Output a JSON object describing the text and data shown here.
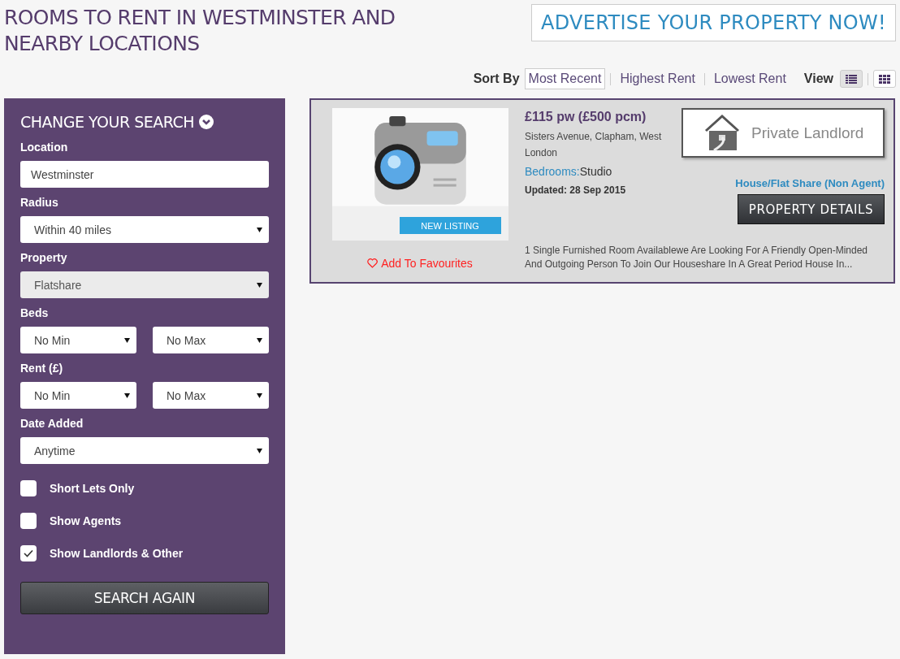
{
  "page_title": "ROOMS TO RENT IN WESTMINSTER AND NEARBY LOCATIONS",
  "advertise_button": "ADVERTISE YOUR PROPERTY NOW!",
  "sort": {
    "label": "Sort By",
    "options": [
      {
        "label": "Most Recent",
        "selected": true
      },
      {
        "label": "Highest Rent",
        "selected": false
      },
      {
        "label": "Lowest Rent",
        "selected": false
      }
    ]
  },
  "view": {
    "label": "View",
    "options": [
      {
        "kind": "list",
        "selected": true
      },
      {
        "kind": "grid",
        "selected": false
      }
    ]
  },
  "sidebar": {
    "title": "CHANGE YOUR SEARCH",
    "fields": [
      {
        "kind": "text",
        "label": "Location",
        "value": "Westminster"
      },
      {
        "kind": "select",
        "label": "Radius",
        "value": "Within 40 miles",
        "disabled": false
      },
      {
        "kind": "select",
        "label": "Property",
        "value": "Flatshare",
        "disabled": true
      },
      {
        "kind": "pair",
        "label": "Beds",
        "values": [
          "No Min",
          "No Max"
        ]
      },
      {
        "kind": "pair",
        "label": "Rent (£)",
        "values": [
          "No Min",
          "No Max"
        ]
      },
      {
        "kind": "select",
        "label": "Date Added",
        "value": "Anytime",
        "disabled": false
      }
    ],
    "checkboxes": [
      {
        "label": "Short Lets Only",
        "checked": false
      },
      {
        "label": "Show Agents",
        "checked": false
      },
      {
        "label": "Show Landlords & Other",
        "checked": true
      }
    ],
    "button": "SEARCH AGAIN"
  },
  "listings": [
    {
      "badge": "NEW LISTING",
      "favourite": "Add To Favourites",
      "price": "£115 pw (£500 pcm)",
      "address": "Sisters Avenue, Clapham, West London",
      "bedrooms_label": "Bedrooms:",
      "bedrooms": "Studio",
      "updated": "Updated: 28 Sep 2015",
      "landlord": "Private Landlord",
      "type": "House/Flat Share (Non Agent)",
      "details_button": "PROPERTY DETAILS",
      "description": "1 Single Furnished Room Availablewe Are Looking For A Friendly Open-Minded And Outgoing Person To Join Our Houseshare In A Great Period House In..."
    }
  ]
}
